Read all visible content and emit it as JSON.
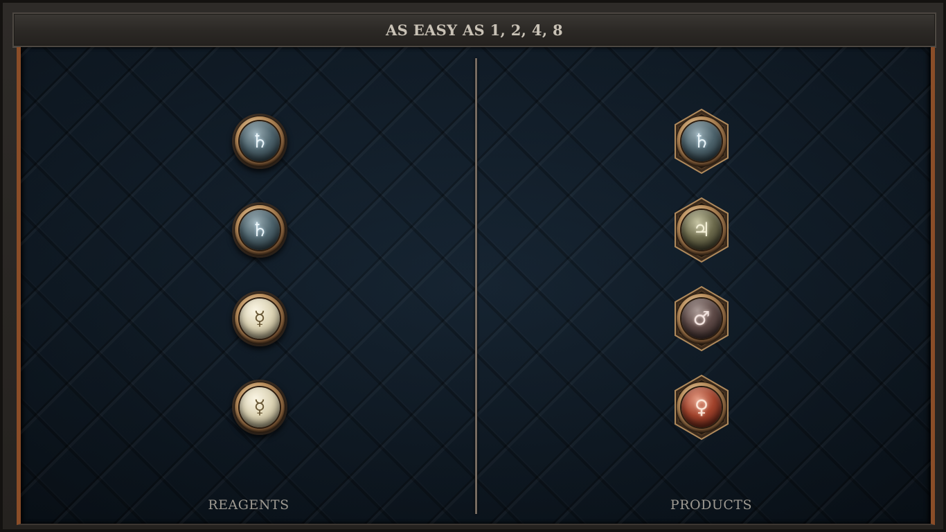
{
  "title": "AS EASY AS 1, 2, 4, 8",
  "reagents": {
    "label": "REAGENTS",
    "items": [
      {
        "symbol": "♄",
        "element": "salt"
      },
      {
        "symbol": "♄",
        "element": "salt"
      },
      {
        "symbol": "☿",
        "element": "mercury"
      },
      {
        "symbol": "☿",
        "element": "mercury"
      }
    ]
  },
  "products": {
    "label": "PRODUCTS",
    "items": [
      {
        "symbol": "♄",
        "element": "salt"
      },
      {
        "symbol": "♃",
        "element": "jupiter"
      },
      {
        "symbol": "♂",
        "element": "mars"
      },
      {
        "symbol": "♀",
        "element": "venus"
      }
    ]
  },
  "colors": {
    "frame_accent": "#8a4d28",
    "title_text": "#c9c2b6",
    "label_text": "#9e9a92",
    "board_bg": "#101c28"
  }
}
